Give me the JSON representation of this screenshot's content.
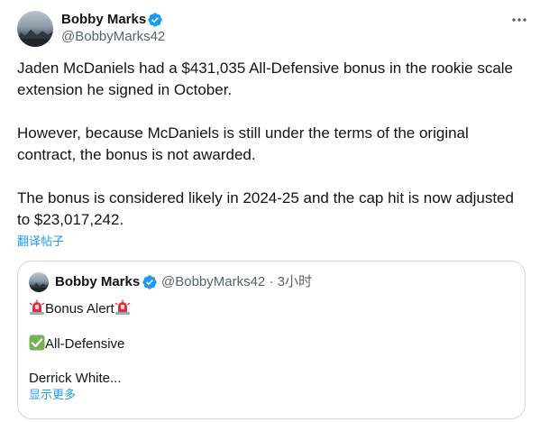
{
  "tweet": {
    "author_name": "Bobby Marks",
    "author_handle": "@BobbyMarks42",
    "paragraphs": [
      "Jaden McDaniels had a $431,035 All-Defensive bonus in the rookie scale extension he signed in October.",
      "However, because McDaniels is still under the terms of the original contract, the bonus is not awarded.",
      "The bonus is considered likely in 2024-25 and the cap hit is now adjusted to $23,017,242."
    ],
    "translate_label": "翻译帖子",
    "more_icon": "more-horizontal-icon",
    "verified_icon": "verified-badge-icon"
  },
  "quote": {
    "author_name": "Bobby Marks",
    "author_meta": "@BobbyMarks42 · 3小时",
    "line1_text": "Bonus Alert",
    "line2_text": "All-Defensive",
    "line3_text": "Derrick White...",
    "show_more_label": "显示更多",
    "siren_icon": "police-light-emoji",
    "check_icon": "check-mark-emoji"
  },
  "colors": {
    "accent": "#1d9bf0",
    "secondary_text": "#536471",
    "border": "#cfd9de",
    "check_green": "#77b255",
    "siren_red": "#dd2e44"
  }
}
